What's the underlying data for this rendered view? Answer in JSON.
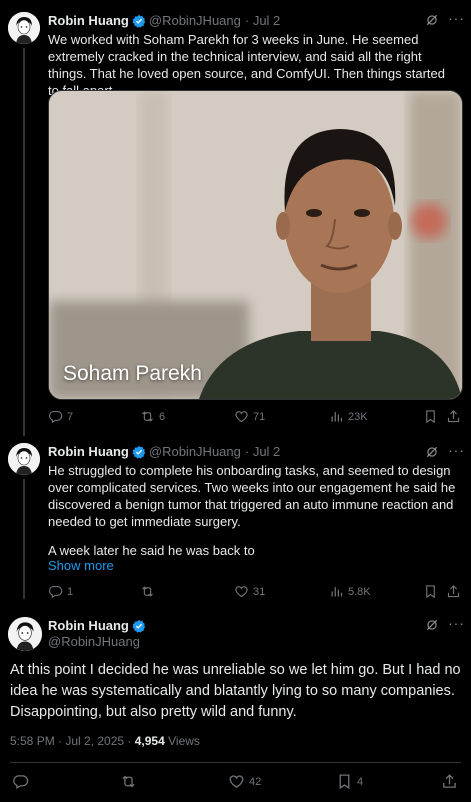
{
  "tweet1": {
    "name": "Robin Huang",
    "handle": "@RobinJHuang",
    "date": "· Jul 2",
    "text": "We worked with Soham Parekh for 3 weeks in June. He seemed extremely cracked in the technical interview, and said all the right things. That he loved open source, and ComfyUI. Then things started to fall apart.",
    "video_caption": "Soham Parekh",
    "replies": "7",
    "reposts": "6",
    "likes": "71",
    "views": "23K"
  },
  "tweet2": {
    "name": "Robin Huang",
    "handle": "@RobinJHuang",
    "date": "· Jul 2",
    "text_p1": "He struggled to complete his onboarding tasks, and seemed to design over complicated services. Two weeks into our engagement he said he discovered a benign tumor that triggered an auto immune reaction and needed to get immediate surgery.",
    "text_p2": "A week later he said he was back to",
    "show_more": "Show more",
    "replies": "1",
    "reposts": "",
    "likes": "31",
    "views": "5.8K"
  },
  "tweet3": {
    "name": "Robin Huang",
    "handle": "@RobinJHuang",
    "text": "At this point I decided he was unreliable so we let him go. But I had no idea he was systematically and blatantly lying to so many companies. Disappointing, but also pretty wild and funny.",
    "time": "5:58 PM · Jul 2, 2025 ·",
    "views_count": "4,954",
    "views_label": "Views",
    "replies": "",
    "reposts": "",
    "likes": "42",
    "bookmarks": "4"
  },
  "colors": {
    "accent": "#1d9bf0",
    "muted": "#71767b",
    "text": "#e7e9ea",
    "background": "#000000"
  }
}
